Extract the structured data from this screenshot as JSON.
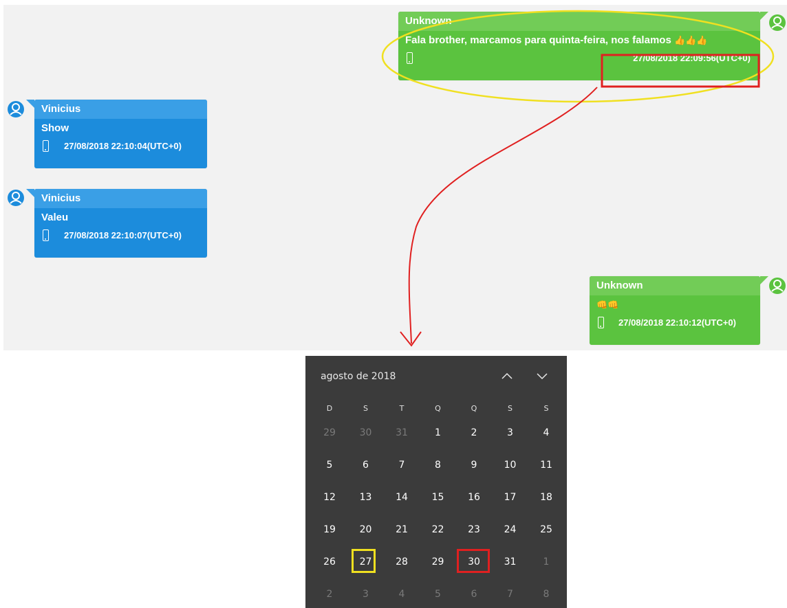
{
  "messages": [
    {
      "sender": "Unknown",
      "text": "Fala brother, marcamos para quinta-feira, nos falamos",
      "emoji": "👍👍👍",
      "timestamp": "27/08/2018 22:09:56(UTC+0)",
      "side": "right"
    },
    {
      "sender": "Vinicius",
      "text": "Show",
      "timestamp": "27/08/2018 22:10:04(UTC+0)",
      "side": "left"
    },
    {
      "sender": "Vinicius",
      "text": "Valeu",
      "timestamp": "27/08/2018 22:10:07(UTC+0)",
      "side": "left"
    },
    {
      "sender": "Unknown",
      "text": "👊👊",
      "timestamp": "27/08/2018 22:10:12(UTC+0)",
      "side": "right"
    }
  ],
  "calendar": {
    "month_label": "agosto de 2018",
    "weekdays": [
      "D",
      "S",
      "T",
      "Q",
      "Q",
      "S",
      "S"
    ],
    "weeks": [
      [
        "29",
        "30",
        "31",
        "1",
        "2",
        "3",
        "4"
      ],
      [
        "5",
        "6",
        "7",
        "8",
        "9",
        "10",
        "11"
      ],
      [
        "12",
        "13",
        "14",
        "15",
        "16",
        "17",
        "18"
      ],
      [
        "19",
        "20",
        "21",
        "22",
        "23",
        "24",
        "25"
      ],
      [
        "26",
        "27",
        "28",
        "29",
        "30",
        "31",
        "1"
      ],
      [
        "2",
        "3",
        "4",
        "5",
        "6",
        "7",
        "8"
      ]
    ],
    "highlight_yellow": "27",
    "highlight_red": "30"
  },
  "colors": {
    "blue_bubble": "#1c8cdc",
    "green_bubble": "#5bc33f",
    "annotation_yellow": "#f0e020",
    "annotation_red": "#e02020",
    "calendar_bg": "#3b3b3b"
  },
  "icons": [
    "user-avatar-icon",
    "phone-icon",
    "chevron-up-icon",
    "chevron-down-icon"
  ]
}
